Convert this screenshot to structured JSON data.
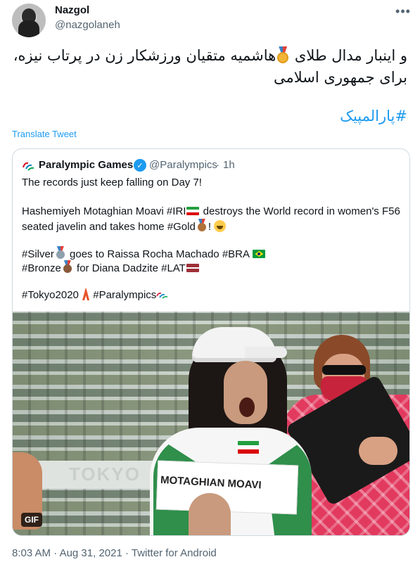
{
  "tweet": {
    "author_name": "Nazgol",
    "author_handle": "@nazgolaneh",
    "more_icon": "ellipsis-icon",
    "text_before_medal": "و اینبار  مدال طلای",
    "text_after_medal": "هاشمیه متقیان ورزشکار زن در پرتاب نیزه، برای جمهوری اسلامی",
    "hashtag": "#پارالمپیک",
    "translate_label": "Translate Tweet",
    "time": "8:03 AM",
    "date": "Aug 31, 2021",
    "source": "Twitter for Android",
    "separator": "·"
  },
  "quote": {
    "name": "Paralympic Games",
    "handle": "@Paralympics",
    "dot": "·",
    "time": "1h",
    "lines": {
      "l1": "The records just keep falling on Day 7!",
      "l2a": "Hashemiyeh Motaghian Moavi #IRI",
      "l2b": " destroys the World record in women's F56",
      "l3a": "seated javelin and takes home #Gold",
      "l3b": "!",
      "l4a": "#Silver",
      "l4b": " goes to Raissa Rocha Machado #BRA",
      "l5a": "#Bronze",
      "l5b": " for Diana Dadzite #LAT",
      "l6a": "#Tokyo2020",
      "l6b": " #Paralympics"
    },
    "media": {
      "badge": "GIF",
      "bib_text": "MOTAGHIAN MOAVI",
      "rail_text": "TOKYO"
    }
  },
  "colors": {
    "link": "#1d9bf0",
    "secondary_text": "#536471",
    "border": "#cfd9de",
    "gold": "#f2b437",
    "silver": "#b8c4cc",
    "bronze": "#b0703a"
  }
}
